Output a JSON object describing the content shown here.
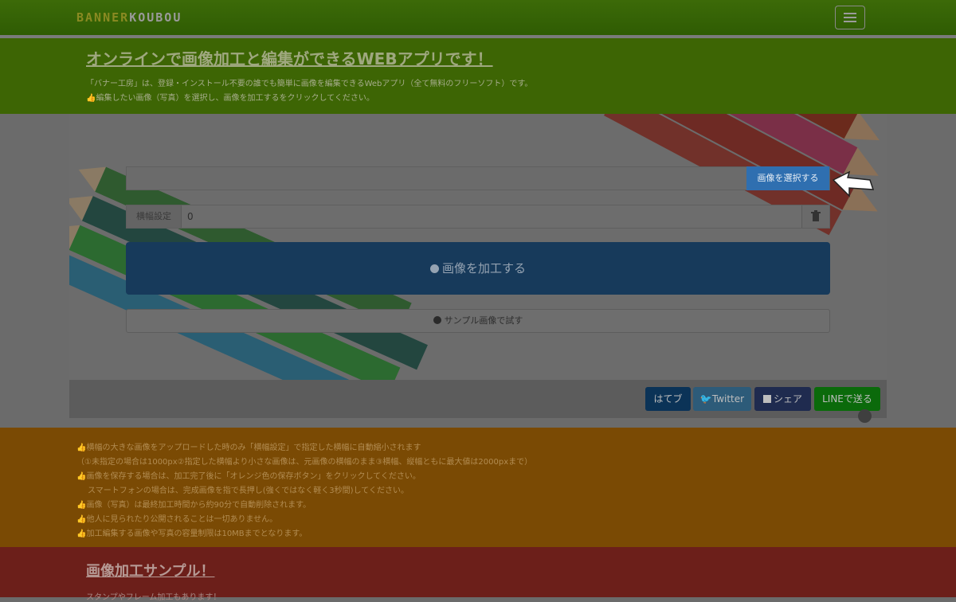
{
  "navbar": {
    "brand_part1": "BANNER",
    "brand_part2": "KOUBOU",
    "menu_icon": "hamburger-icon"
  },
  "hero": {
    "title": "オンラインで画像加工と編集ができるWEBアプリです！",
    "line1": "「バナー工房」は、登録・インストール不要の誰でも簡単に画像を編集できるWebアプリ（全て無料のフリーソフト）です。",
    "line2": "編集したい画像（写真）を選択し、画像を加工するをクリックしてください。"
  },
  "form": {
    "select_button": "画像を選択する",
    "width_label": "横幅設定",
    "width_value": "0",
    "process_button": "画像を加工する",
    "sample_button": "サンプル画像で試す"
  },
  "share": {
    "hatena": "はてブ",
    "twitter": "Twitter",
    "facebook": "シェア",
    "line": "LINEで送る"
  },
  "notes": [
    "横幅の大きな画像をアップロードした時のみ「横幅設定」で指定した横幅に自動縮小されます",
    "（①未指定の場合は1000px②指定した横幅より小さな画像は、元画像の横幅のまま③横幅、縦幅ともに最大値は2000pxまで）",
    "画像を保存する場合は、加工完了後に「オレンジ色の保存ボタン」をクリックしてください。",
    "スマートフォンの場合は、完成画像を指で長押し(強くではなく軽く3秒間)してください。",
    "画像（写真）は最終加工時間から約90分で自動削除されます。",
    "他人に見られたり公開されることは一切ありません。",
    "加工編集する画像や写真の容量制限は10MBまでとなります。"
  ],
  "samples": {
    "title": "画像加工サンプル！",
    "subtitle": "スタンプやフレーム加工もあります！"
  },
  "colors": {
    "nav": "#3c6a08",
    "hero": "#3d6504",
    "select_button": "#2f6fb0",
    "process_button": "#173a5b",
    "notes": "#7a4a04",
    "samples": "#6c1f1a"
  }
}
